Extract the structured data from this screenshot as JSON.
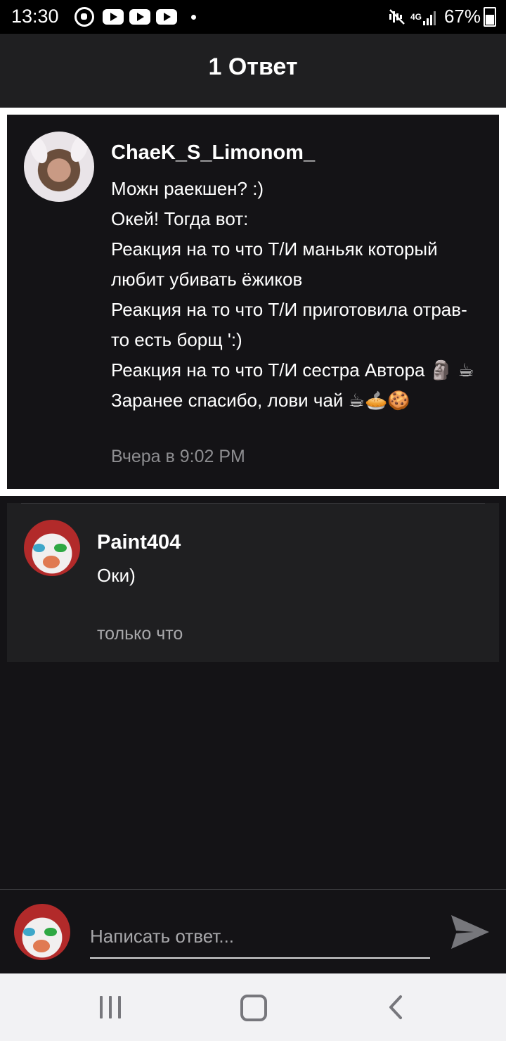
{
  "status_bar": {
    "time": "13:30",
    "network": "4G",
    "battery": "67%",
    "icons": [
      "whatsapp-icon",
      "youtube-icon",
      "youtube-icon",
      "youtube-icon",
      "notification-dot-icon",
      "mute-icon",
      "signal-icon",
      "battery-icon"
    ]
  },
  "header": {
    "title": "1 Ответ"
  },
  "original_comment": {
    "author": "ChaeK_S_Limonom_",
    "lines": [
      "Можн раекшен? :)",
      "Окей! Тогда вот:",
      "Реакция на то что Т/И маньяк который любит убивать ёжиков",
      "Реакция на то что Т/И приготовила отрав- то есть борщ ':)",
      "Реакция на то что Т/И сестра Автора 🗿 ☕",
      "Заранее спасибо, лови чай ☕🥧🍪"
    ],
    "time": "Вчера в 9:02 PM"
  },
  "reply": {
    "author": "Paint404",
    "text": "Оки)",
    "time": "только что"
  },
  "compose": {
    "placeholder": "Написать ответ..."
  },
  "nav": {
    "icons": [
      "recents-icon",
      "home-icon",
      "back-icon"
    ]
  }
}
